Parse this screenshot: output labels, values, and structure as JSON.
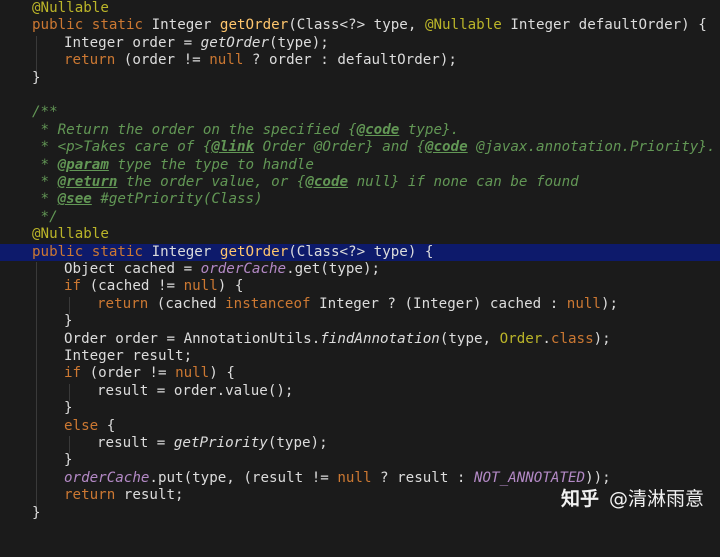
{
  "colors": {
    "background": "#1b1b1b",
    "keyword": "#cc7832",
    "annotation": "#bbb529",
    "method_declaration": "#ffc66d",
    "field_or_static": "#b389c5",
    "javadoc": "#629755",
    "current_line": "#0d1a6b"
  },
  "icons": {
    "gutter_intention": "lightbulb-icon"
  },
  "code": {
    "l1": "@Nullable",
    "l2": "public static Integer getOrder(Class<?> type, @Nullable Integer defaultOrder) {",
    "l3": "Integer order = getOrder(type);",
    "l4": "return (order != null ? order : defaultOrder);",
    "l5": "}",
    "l7": "/**",
    "l8": " * Return the order on the specified {@code type}.",
    "l9": " * <p>Takes care of {@link Order @Order} and {@code @javax.annotation.Priority}.",
    "l10": " * @param type the type to handle",
    "l11": " * @return the order value, or {@code null} if none can be found",
    "l12": " * @see #getPriority(Class)",
    "l13": " */",
    "l14": "@Nullable",
    "l15": "public static Integer getOrder(Class<?> type) {",
    "l16": "Object cached = orderCache.get(type);",
    "l17": "if (cached != null) {",
    "l18": "return (cached instanceof Integer ? (Integer) cached : null);",
    "l19": "}",
    "l20": "Order order = AnnotationUtils.findAnnotation(type, Order.class);",
    "l21": "Integer result;",
    "l22": "if (order != null) {",
    "l23": "result = order.value();",
    "l24": "}",
    "l25": "else {",
    "l26": "result = getPriority(type);",
    "l27": "}",
    "l28": "orderCache.put(type, (result != null ? result : NOT_ANNOTATED));",
    "l29": "return result;",
    "l30": "}"
  },
  "watermark": {
    "logo": "知乎",
    "author": "@清淋雨意"
  }
}
